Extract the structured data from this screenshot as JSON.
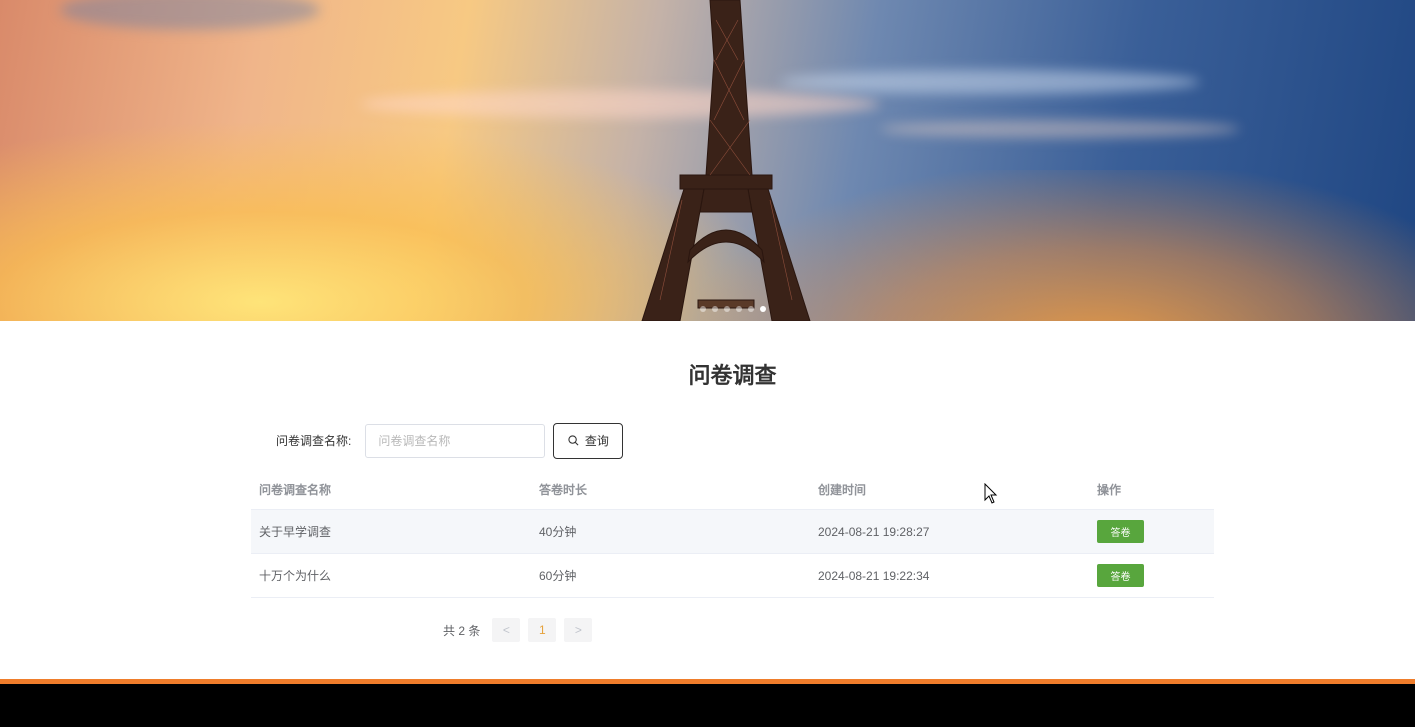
{
  "banner": {
    "image": "eiffel-tower-sunset",
    "slides": 1
  },
  "section": {
    "title": "问卷调查"
  },
  "search": {
    "label": "问卷调查名称:",
    "placeholder": "问卷调查名称",
    "button_label": "查询",
    "button_icon": "search-icon"
  },
  "table": {
    "columns": [
      "问卷调查名称",
      "答卷时长",
      "创建时间",
      "操作"
    ],
    "rows": [
      {
        "name": "关于早学调查",
        "duration": "40分钟",
        "created": "2024-08-21 19:28:27",
        "action": "答卷"
      },
      {
        "name": "十万个为什么",
        "duration": "60分钟",
        "created": "2024-08-21 19:22:34",
        "action": "答卷"
      }
    ]
  },
  "pagination": {
    "total": "共 2 条",
    "prev": "<",
    "page": "1",
    "next": ">"
  },
  "colors": {
    "accent": "#58a63d",
    "footer_accent": "#ef7d2b",
    "footer_bg": "#000000"
  }
}
